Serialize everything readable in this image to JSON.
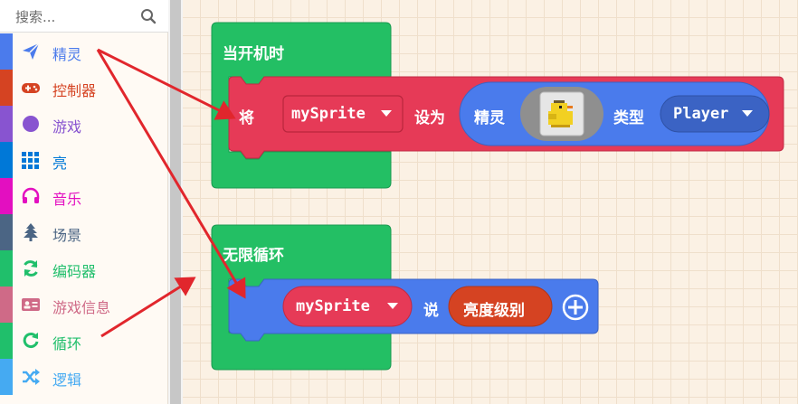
{
  "search": {
    "placeholder": "搜索..."
  },
  "toolbox": [
    {
      "label": "精灵",
      "color": "#4b7bec",
      "icon": "paper-plane-icon"
    },
    {
      "label": "控制器",
      "color": "#d54322",
      "icon": "gamepad-icon"
    },
    {
      "label": "游戏",
      "color": "#8854d0",
      "icon": "circle-icon"
    },
    {
      "label": "亮",
      "color": "#0078d7",
      "icon": "grid-icon"
    },
    {
      "label": "音乐",
      "color": "#e30fc0",
      "icon": "headphones-icon"
    },
    {
      "label": "场景",
      "color": "#4b6584",
      "icon": "tree-icon"
    },
    {
      "label": "编码器",
      "color": "#20bf6b",
      "icon": "refresh-icon"
    },
    {
      "label": "游戏信息",
      "color": "#cf6a87",
      "icon": "id-card-icon"
    },
    {
      "label": "循环",
      "color": "#20bf6b",
      "icon": "loop-icon"
    },
    {
      "label": "逻辑",
      "color": "#45aaf2",
      "icon": "shuffle-icon"
    }
  ],
  "blocks": {
    "on_start": {
      "hat_label": "当开机时",
      "set_label": "将",
      "variable": "mySprite",
      "to_label": "设为",
      "sprite_label": "精灵",
      "image": "duck-sprite",
      "kind_label": "类型",
      "kind_value": "Player"
    },
    "forever": {
      "hat_label": "无限循环",
      "variable": "mySprite",
      "say_label": "说",
      "value": "亮度级别"
    }
  }
}
